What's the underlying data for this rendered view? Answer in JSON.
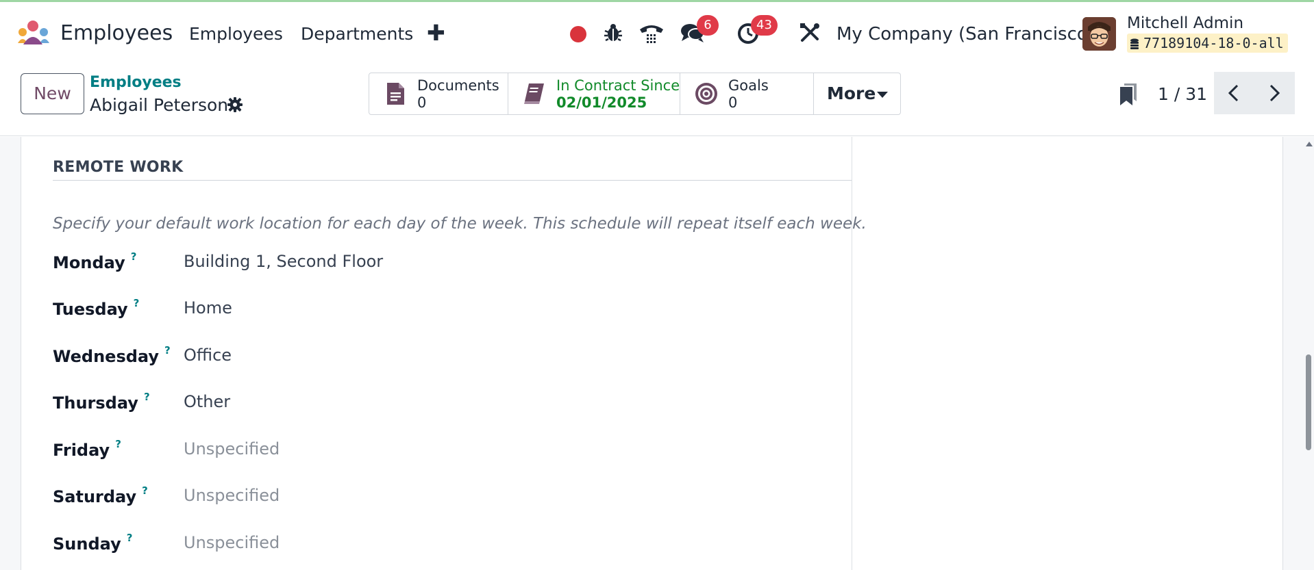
{
  "navbar": {
    "app_name": "Employees",
    "menu": [
      "Employees",
      "Departments"
    ],
    "plus_label": "✚",
    "messages_count": "6",
    "activities_count": "43",
    "company": "My Company (San Francisco)",
    "user_name": "Mitchell Admin",
    "database": "77189104-18-0-all"
  },
  "control": {
    "new_label": "New",
    "breadcrumb_parent": "Employees",
    "breadcrumb_current": "Abigail Peterson",
    "smart_buttons": {
      "documents": {
        "label": "Documents",
        "value": "0"
      },
      "contract": {
        "label": "In Contract Since",
        "value": "02/01/2025"
      },
      "goals": {
        "label": "Goals",
        "value": "0"
      }
    },
    "more_label": "More",
    "pager": "1 / 31"
  },
  "remote_work": {
    "title": "REMOTE WORK",
    "hint": "Specify your default work location for each day of the week. This schedule will repeat itself each week.",
    "help_mark": "?",
    "days": [
      {
        "day": "Monday",
        "location": "Building 1, Second Floor"
      },
      {
        "day": "Tuesday",
        "location": "Home"
      },
      {
        "day": "Wednesday",
        "location": "Office"
      },
      {
        "day": "Thursday",
        "location": "Other"
      },
      {
        "day": "Friday",
        "location": "Unspecified"
      },
      {
        "day": "Saturday",
        "location": "Unspecified"
      },
      {
        "day": "Sunday",
        "location": "Unspecified"
      }
    ]
  },
  "colors": {
    "brand": "#714b67",
    "link": "#017e84",
    "badge": "#e03a48",
    "contract_green": "#118a2a",
    "record_red": "#d9343c"
  }
}
